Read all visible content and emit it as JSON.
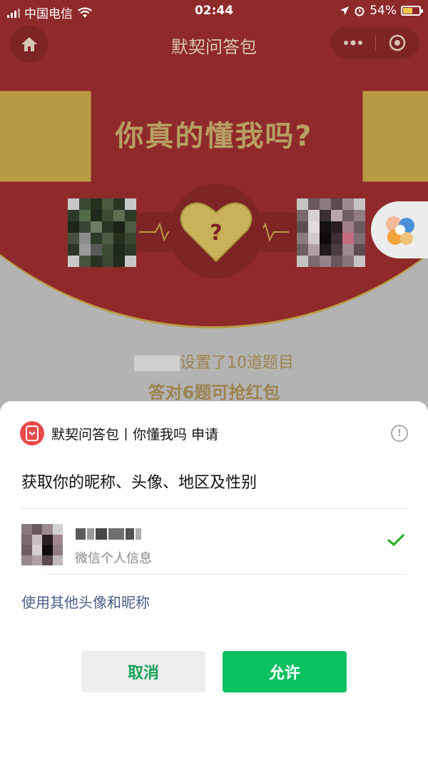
{
  "status_bar": {
    "carrier": "中国电信",
    "time": "02:44",
    "battery": "54%",
    "battery_level": 0.54
  },
  "nav": {
    "title": "默契问答包"
  },
  "page": {
    "headline": "你真的懂我吗?",
    "heart_symbol": "?",
    "info_line1": "设置了10道题目",
    "info_line2": "答对6题可抢红包"
  },
  "auth": {
    "request_title": "默契问答包丨你懂我吗 申请",
    "description": "获取你的昵称、头像、地区及性别",
    "user_option_desc": "微信个人信息",
    "other_option": "使用其他头像和昵称",
    "cancel_label": "取消",
    "allow_label": "允许"
  },
  "colors": {
    "brand_red": "#8f2a2a",
    "wechat_green": "#0bc160",
    "link_blue": "#4a5e8a"
  }
}
